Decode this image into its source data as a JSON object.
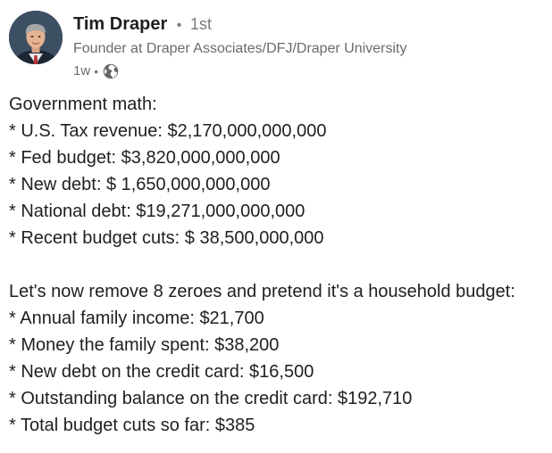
{
  "author": {
    "name": "Tim Draper",
    "separator": "•",
    "degree": "1st",
    "headline": "Founder at Draper Associates/DFJ/Draper University",
    "time": "1w",
    "visibility_icon": "globe-icon",
    "avatar_icon": "avatar"
  },
  "post": {
    "intro": "Government math:",
    "government_items": [
      "* U.S. Tax revenue: $2,170,000,000,000",
      "* Fed budget: $3,820,000,000,000",
      "* New debt: $ 1,650,000,000,000",
      "* National debt: $19,271,000,000,000",
      "* Recent budget cuts: $ 38,500,000,000"
    ],
    "household_intro": "Let's now remove 8 zeroes and pretend it's a household budget:",
    "household_items": [
      "* Annual family income: $21,700",
      "* Money the family spent: $38,200",
      "* New debt on the credit card: $16,500",
      "* Outstanding balance on the credit card: $192,710",
      "* Total budget cuts so far: $385"
    ]
  },
  "colors": {
    "text_primary": "#1f1f1f",
    "text_secondary": "#6b6b6b",
    "background": "#ffffff"
  }
}
